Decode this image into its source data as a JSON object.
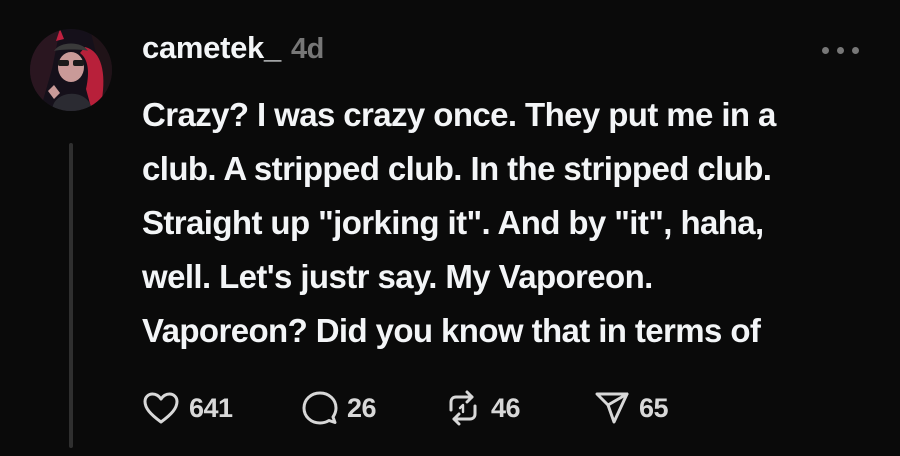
{
  "post": {
    "username": "cametek_",
    "timestamp": "4d",
    "body_lines": [
      "Crazy? I was crazy once. They put me in a",
      "club. A stripped club. In the stripped club.",
      "Straight up \"jorking it\". And by \"it\", haha,",
      "well. Let's justr say. My Vaporeon.",
      "Vaporeon? Did you know that in terms of"
    ],
    "actions": {
      "likes": "641",
      "replies": "26",
      "reposts": "46",
      "shares": "65"
    },
    "icons": {
      "more": "more-options-icon",
      "like": "heart-icon",
      "reply": "speech-bubble-icon",
      "repost": "repost-arrows-icon",
      "share": "paper-plane-icon"
    },
    "colors": {
      "background": "#0a0a0a",
      "text": "#f3f5f7",
      "muted": "#777777"
    }
  }
}
